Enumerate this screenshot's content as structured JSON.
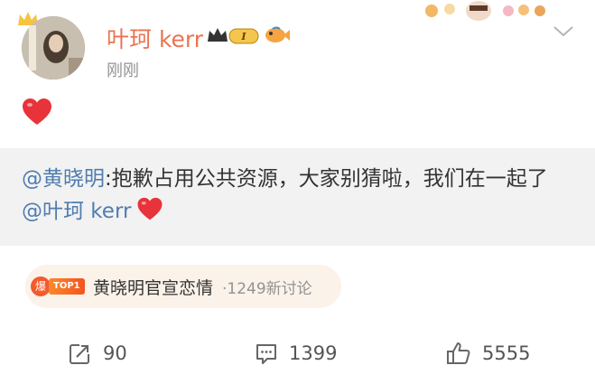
{
  "post": {
    "author": {
      "name": "叶珂 kerr",
      "level_badge": "I"
    },
    "timestamp": "刚刚",
    "body_emoji": "heart",
    "quote": {
      "mention_author": "@黄晓明",
      "text": ":抱歉占用公共资源，大家别猜啦，我们在一起了",
      "mention_tag": "@叶珂 kerr",
      "trailing_emoji": "heart"
    },
    "hot_topic": {
      "burst_label": "爆",
      "rank_badge": "TOP1",
      "title": "黄晓明官宣恋情",
      "discussion_count": "·1249新讨论"
    },
    "actions": {
      "repost_count": "90",
      "comment_count": "1399",
      "like_count": "5555"
    }
  },
  "colors": {
    "username": "#eb7350",
    "mention": "#507daf",
    "heart": "#e8333a",
    "quote_bg": "#f2f2f2",
    "topic_bg": "#fbf2e9",
    "muted_text": "#939393"
  },
  "icons": [
    "crown-icon",
    "fish-badge-icon",
    "chevron-down-icon",
    "heart-icon",
    "repost-icon",
    "comment-icon",
    "like-icon",
    "burst-icon"
  ]
}
